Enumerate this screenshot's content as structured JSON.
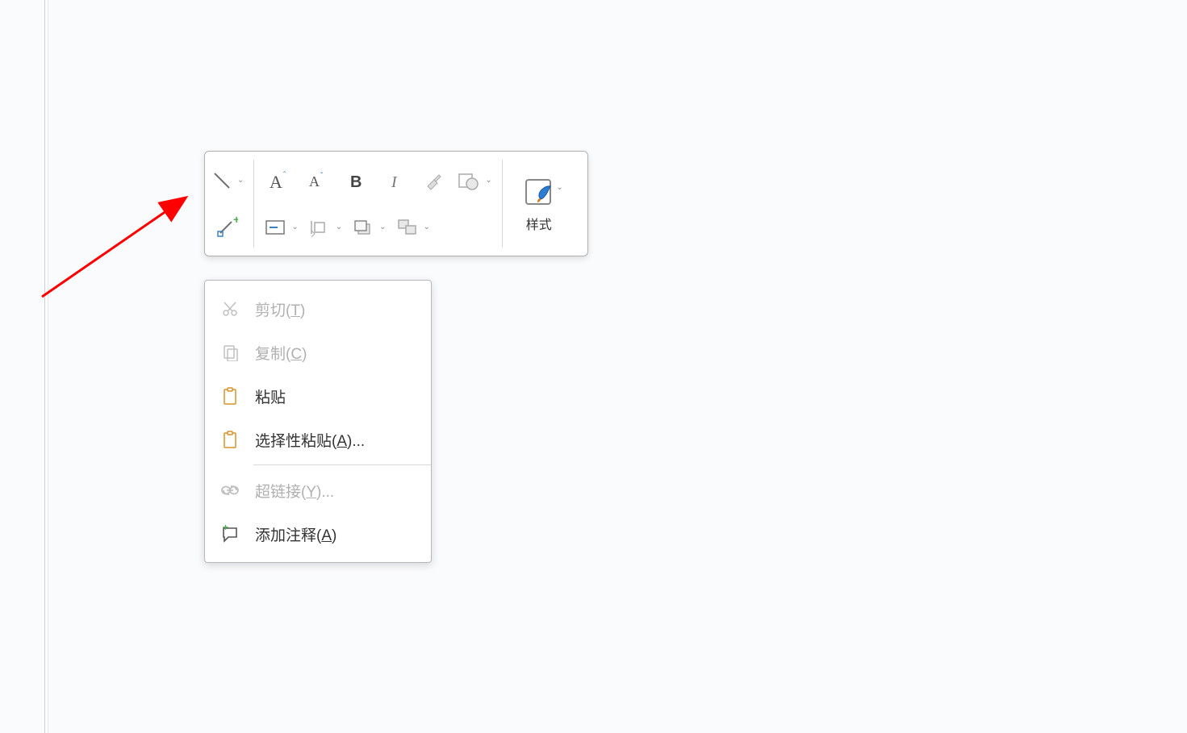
{
  "toolbar": {
    "styles_label": "样式"
  },
  "context_menu": {
    "cut_pre": "剪切(",
    "cut_u": "T",
    "cut_post": ")",
    "copy_pre": "复制(",
    "copy_u": "C",
    "copy_post": ")",
    "paste": "粘贴",
    "paste_special_pre": "选择性粘贴(",
    "paste_special_u": "A",
    "paste_special_post": ")...",
    "hyperlink_pre": "超链接(",
    "hyperlink_u": "Y",
    "hyperlink_post": ")...",
    "comment_pre": "添加注释(",
    "comment_u": "A",
    "comment_post": ")"
  }
}
